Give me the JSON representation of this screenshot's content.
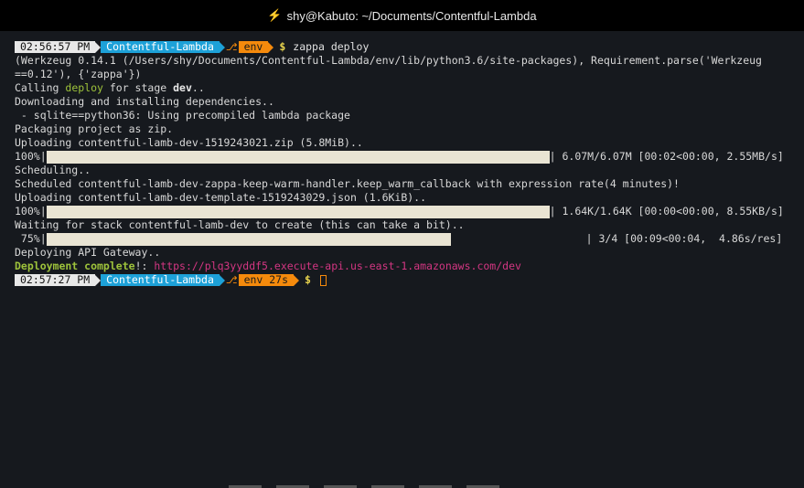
{
  "window": {
    "title": "shy@Kabuto: ~/Documents/Contentful-Lambda"
  },
  "prompt1": {
    "time": "02:56:57 PM",
    "dir": "Contentful-Lambda",
    "venv": "env",
    "cmd": "zappa deploy"
  },
  "lines": {
    "werkzeug1": "(Werkzeug 0.14.1 (/Users/shy/Documents/Contentful-Lambda/env/lib/python3.6/site-packages), Requirement.parse('Werkzeug",
    "werkzeug2": "==0.12'), {'zappa'})",
    "calling_pre": "Calling ",
    "calling_deploy": "deploy",
    "calling_mid": " for stage ",
    "calling_stage": "dev",
    "calling_post": "..",
    "downloading": "Downloading and installing dependencies..",
    "sqlite": " - sqlite==python36: Using precompiled lambda package",
    "packaging": "Packaging project as zip.",
    "uploading_zip": "Uploading contentful-lamb-dev-1519243021.zip (5.8MiB)..",
    "bar1_pct": "100%|",
    "bar1_stats": "| 6.07M/6.07M [00:02<00:00, 2.55MB/s]",
    "scheduling": "Scheduling..",
    "scheduled": "Scheduled contentful-lamb-dev-zappa-keep-warm-handler.keep_warm_callback with expression rate(4 minutes)!",
    "uploading_tpl": "Uploading contentful-lamb-dev-template-1519243029.json (1.6KiB)..",
    "bar2_pct": "100%|",
    "bar2_stats": "| 1.64K/1.64K [00:00<00:00, 8.55KB/s]",
    "waiting": "Waiting for stack contentful-lamb-dev to create (this can take a bit)..",
    "bar3_pct": " 75%|",
    "bar3_stats": "| 3/4 [00:09<00:04,  4.86s/res]",
    "deploying_api": "Deploying API Gateway..",
    "complete_label": "Deployment complete",
    "complete_sep": "!: ",
    "url": "https://plq3yyddf5.execute-api.us-east-1.amazonaws.com/dev"
  },
  "progress": {
    "bar1": 1.0,
    "bar2": 1.0,
    "bar3": 0.75
  },
  "prompt2": {
    "time": "02:57:27 PM",
    "dir": "Contentful-Lambda",
    "venv": "env 27s"
  },
  "colors": {
    "background": "#16191e",
    "time_segment": "#e8e8e8",
    "dir_segment": "#1da1d8",
    "venv_segment": "#f58a0c",
    "progress_fill": "#e9e4d3",
    "green": "#9ec33b",
    "url": "#d33682"
  }
}
